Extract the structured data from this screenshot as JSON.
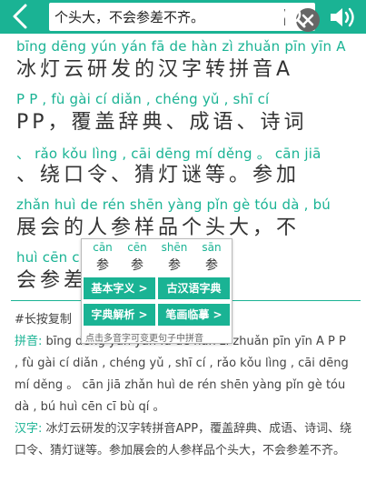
{
  "search": {
    "value": "个头大，不会参差不齐。"
  },
  "main": {
    "lines": [
      {
        "pinyin": "bīng dēng yún yán fā de hàn zì zhuǎn pīn yīn A",
        "hanzi": "冰灯云研发的汉字转拼音A"
      },
      {
        "pinyin": "P P ,   fù gài cí diǎn ,   chéng yǔ ,   shī cí",
        "hanzi": "PP，覆盖辞典、成语、诗词"
      },
      {
        "pinyin": "、 rǎo kǒu lìng ,   cāi dēng mí děng 。 cān jiā",
        "hanzi": "、绕口令、猜灯谜等。参加"
      },
      {
        "pinyin": "zhǎn huì de rén shēn yàng pǐn gè tóu dà ,   bú",
        "hanzi": "展会的人参样品个头大，不"
      },
      {
        "pinyin": "huì cēn c",
        "hanzi": "会参差"
      }
    ]
  },
  "popup": {
    "options": [
      {
        "pinyin": "cān",
        "hanzi": "参"
      },
      {
        "pinyin": "cēn",
        "hanzi": "参"
      },
      {
        "pinyin": "shēn",
        "hanzi": "参"
      },
      {
        "pinyin": "sān",
        "hanzi": "参"
      }
    ],
    "buttons": [
      "基本字义 >",
      "古汉语字典",
      "字典解析 >",
      "笔画临摹 >"
    ],
    "hint": "点击多音字可变更句子中拼音"
  },
  "bottom": {
    "copy_hint": "#长按复制",
    "pinyin_label": "拼音:",
    "pinyin_text": "bīng dēng yún yán fā de hàn zì zhuǎn pīn yīn A P P ,  fù gài cí diǎn ,  chéng yǔ ,  shī cí ,  rǎo kǒu lìng ,  cāi dēng mí děng 。 cān jiā zhǎn huì de rén shēn yàng pǐn gè tóu dà ,  bú huì cēn cī bù qí 。",
    "hanzi_label": "汉字:",
    "hanzi_text": "冰灯云研发的汉字转拼音APP，覆盖辞典、成语、诗词、绕口令、猜灯谜等。参加展会的人参样品个头大，不会参差不齐。"
  },
  "colors": {
    "accent": "#1ab394",
    "text": "#333333"
  }
}
